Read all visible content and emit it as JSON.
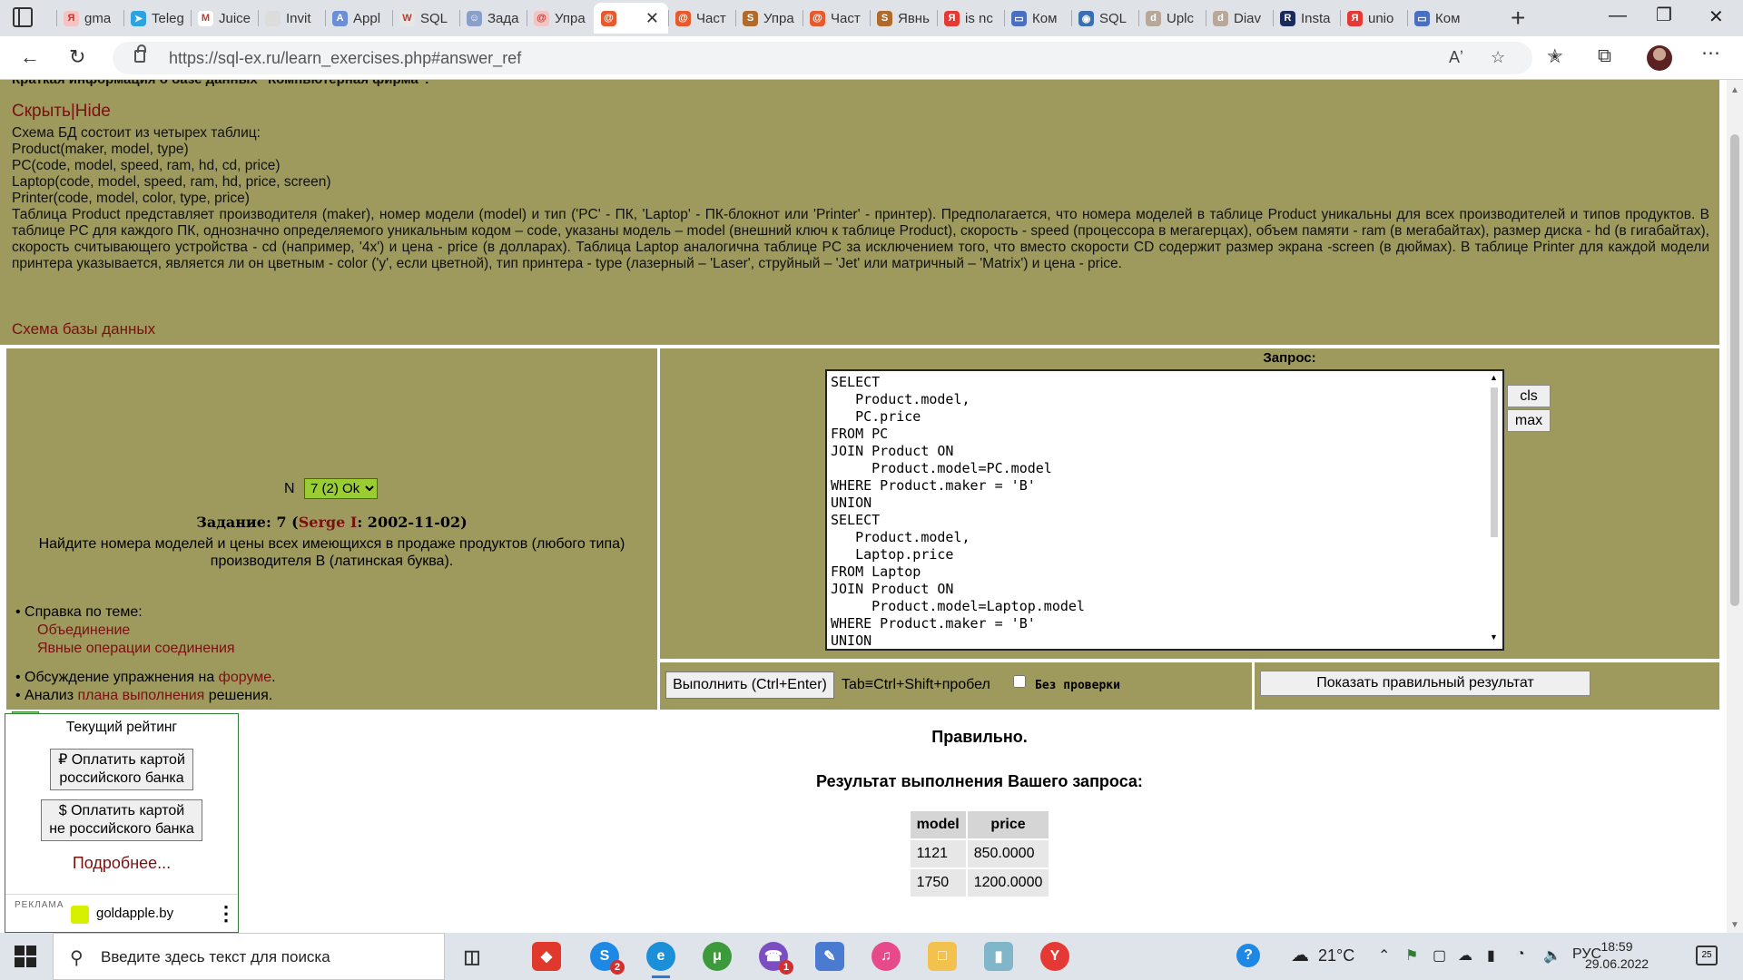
{
  "browser": {
    "tabs": [
      {
        "label": "gma",
        "icon": "yandex-icon",
        "color": "#f5c3c3"
      },
      {
        "label": "Teleg",
        "icon": "telegram-icon",
        "color": "#2aa3e0"
      },
      {
        "label": "Juice",
        "icon": "gmail-icon",
        "color": "#ffffff"
      },
      {
        "label": "Invit",
        "icon": "apple-icon",
        "color": "#dcdcdc"
      },
      {
        "label": "Appl",
        "icon": "app-icon",
        "color": "#6b8fd6"
      },
      {
        "label": "SQL",
        "icon": "w-icon",
        "color": "#e6e6e6"
      },
      {
        "label": "Зада",
        "icon": "contact-icon",
        "color": "#8aa0c8"
      },
      {
        "label": "Упра",
        "icon": "swirl-icon",
        "color": "#f1c5c5"
      },
      {
        "label": "",
        "icon": "swirl-icon",
        "color": "#e85a2b",
        "active": true
      },
      {
        "label": "Част",
        "icon": "swirl-icon",
        "color": "#e85a2b"
      },
      {
        "label": "Упра",
        "icon": "s-icon",
        "color": "#b06a2c"
      },
      {
        "label": "Част",
        "icon": "swirl-icon",
        "color": "#e85a2b"
      },
      {
        "label": "Явнь",
        "icon": "s-icon",
        "color": "#b06a2c"
      },
      {
        "label": "is nc",
        "icon": "yandex-icon",
        "color": "#e53935"
      },
      {
        "label": "Ком",
        "icon": "screen-icon",
        "color": "#4a6fc0"
      },
      {
        "label": "SQL",
        "icon": "camera-icon",
        "color": "#3a6fb0"
      },
      {
        "label": "Uplc",
        "icon": "d-icon",
        "color": "#b8a89a"
      },
      {
        "label": "Diav",
        "icon": "d-icon",
        "color": "#b8a89a"
      },
      {
        "label": "Insta",
        "icon": "r-icon",
        "color": "#1a2a5a"
      },
      {
        "label": "unio",
        "icon": "yandex-icon",
        "color": "#e53935"
      },
      {
        "label": "Ком",
        "icon": "screen-icon",
        "color": "#4a6fc0"
      }
    ],
    "url": "https://sql-ex.ru/learn_exercises.php#answer_ref"
  },
  "schema_info": {
    "cut_heading": "Краткая информация о базе данных \"Компьютерная фирма\":",
    "hide_link": "Скрыть|Hide",
    "intro": "Схема БД состоит из четырех таблиц:",
    "tables": [
      "Product(maker, model, type)",
      "PC(code, model, speed, ram, hd, cd, price)",
      "Laptop(code, model, speed, ram, hd, price, screen)",
      "Printer(code, model, color, type, price)"
    ],
    "description": "Таблица Product представляет производителя (maker), номер модели (model) и тип ('PC' - ПК, 'Laptop' - ПК-блокнот или 'Printer' - принтер). Предполагается, что номера моделей в таблице Product уникальны для всех производителей и типов продуктов. В таблице PC для каждого ПК, однозначно определяемого уникальным кодом – code, указаны модель – model (внешний ключ к таблице Product), скорость - speed (процессора в мегагерцах), объем памяти - ram (в мегабайтах), размер диска - hd (в гигабайтах), скорость считывающего устройства - cd (например, '4x') и цена - price (в долларах). Таблица Laptop аналогична таблице PC за исключением того, что вместо скорости CD содержит размер экрана -screen (в дюймах). В таблице Printer для каждой модели принтера указывается, является ли он цветным - color ('y', если цветной), тип принтера - type (лазерный – 'Laser', струйный – 'Jet' или матричный – 'Matrix') и цена - price.",
    "db_schema_link": "Схема базы данных"
  },
  "task": {
    "n_label": "N",
    "selected_option": "7 (2) Ok",
    "heading_prefix": "Задание: 7 (",
    "author": "Serge I",
    "heading_suffix": ": 2002-11-02)",
    "text": "Найдите номера моделей и цены всех имеющихся в продаже продуктов (любого типа) производителя B (латинская буква).",
    "help_label": "• Справка по теме:",
    "help_links": [
      "Объединение",
      "Явные операции соединения"
    ],
    "forum_prefix": "• Обсуждение упражнения на ",
    "forum_link": "форуме",
    "forum_suffix": ".",
    "plan_prefix": "• Анализ ",
    "plan_link": "плана выполнения",
    "plan_suffix": " решения."
  },
  "query": {
    "label": "Запрос:",
    "sql": "SELECT\n   Product.model,\n   PC.price\nFROM PC\nJOIN Product ON\n     Product.model=PC.model\nWHERE Product.maker = 'B'\nUNION\nSELECT\n   Product.model,\n   Laptop.price\nFROM Laptop\nJOIN Product ON\n     Product.model=Laptop.model\nWHERE Product.maker = 'B'\nUNION",
    "cls_label": "cls",
    "max_label": "max",
    "execute_label": "Выполнить (Ctrl+Enter)",
    "tab_hint": "Tab≡Ctrl+Shift+пробел",
    "no_check_label": "Без проверки",
    "show_result_label": "Показать правильный результат"
  },
  "rating": {
    "title": "Текущий рейтинг",
    "pay_ru": "₽ Оплатить картой\nроссийского банка",
    "pay_foreign": "$ Оплатить картой\nне российского банка",
    "more": "Подробнее...",
    "ad_label": "РЕКЛАМА",
    "ad_text": "goldapple.by"
  },
  "result": {
    "status": "Правильно.",
    "title": "Результат выполнения Вашего запроса:",
    "columns": [
      "model",
      "price"
    ],
    "rows": [
      [
        "1121",
        "850.0000"
      ],
      [
        "1750",
        "1200.0000"
      ]
    ]
  },
  "taskbar": {
    "search_placeholder": "Введите здесь текст для поиска",
    "weather": "21°C",
    "lang": "РУС",
    "time": "18:59",
    "date": "29.06.2022",
    "notifications": "25",
    "skype_badge": "2",
    "viber_badge": "1"
  },
  "colors": {
    "olive_panel": "#9e9a5e",
    "link": "#7a1010",
    "select_green": "#9acd32"
  }
}
